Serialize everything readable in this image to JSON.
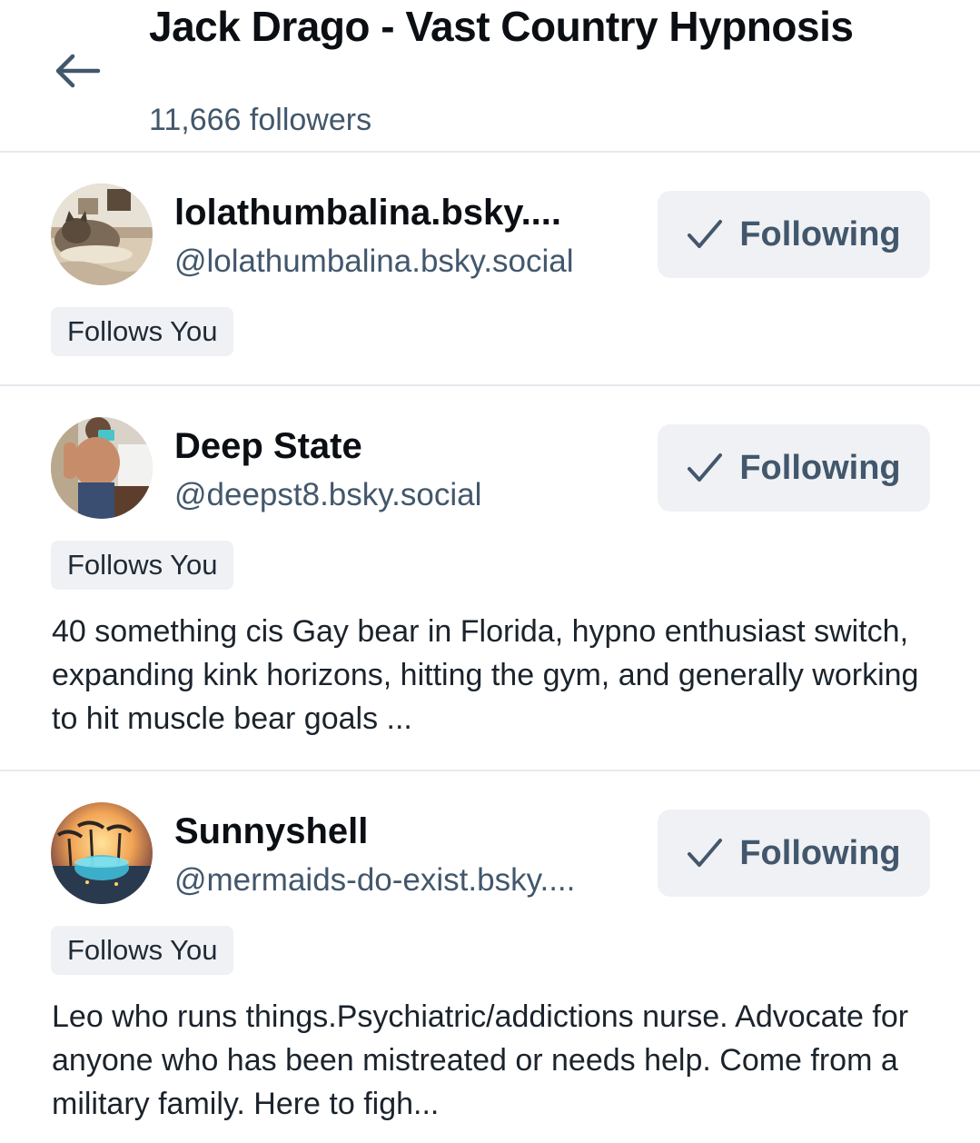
{
  "header": {
    "title": "Jack Drago - Vast Country Hypnosis",
    "followers": "11,666 followers"
  },
  "users": [
    {
      "name": "lolathumbalina.bsky....",
      "handle": "@lolathumbalina.bsky.social",
      "button": "Following",
      "follows_you": "Follows You",
      "bio": ""
    },
    {
      "name": "Deep State",
      "handle": "@deepst8.bsky.social",
      "button": "Following",
      "follows_you": "Follows You",
      "bio": "40 something cis Gay bear in Florida, hypno enthusiast switch, expanding kink horizons, hitting the gym, and generally working to hit muscle bear goals ..."
    },
    {
      "name": "Sunnyshell",
      "handle": "@mermaids-do-exist.bsky....",
      "button": "Following",
      "follows_you": "Follows You",
      "bio": "Leo who runs things.Psychiatric/addictions nurse. Advocate for anyone who has been mistreated or needs help. Come from a military family. Here to figh..."
    }
  ],
  "colors": {
    "muted_text": "#42576c",
    "pill_bg": "#eff1f4",
    "divider": "#e6e9ee"
  },
  "icons": {
    "back": "arrow-left-icon",
    "check": "check-icon"
  }
}
